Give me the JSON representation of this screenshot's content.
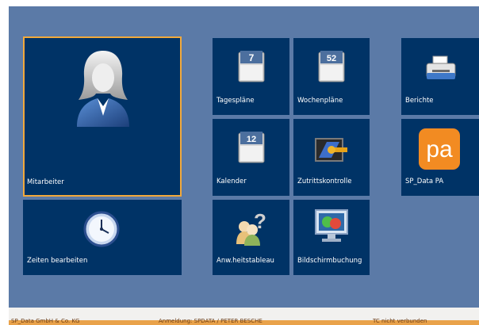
{
  "tiles": [
    {
      "id": "mitarbeiter",
      "label": "Mitarbeiter",
      "icon": "user-icon"
    },
    {
      "id": "zeiten",
      "label": "Zeiten bearbeiten",
      "icon": "clock-icon"
    },
    {
      "id": "tagesplaene",
      "label": "Tagespläne",
      "icon": "day-calendar-icon",
      "badge": "7"
    },
    {
      "id": "wochenplaene",
      "label": "Wochenpläne",
      "icon": "week-calendar-icon",
      "badge": "52"
    },
    {
      "id": "kalender",
      "label": "Kalender",
      "icon": "calendar-icon",
      "badge": "12"
    },
    {
      "id": "zutritt",
      "label": "Zutrittskontrolle",
      "icon": "access-control-icon"
    },
    {
      "id": "anwesenheit",
      "label": "Anw.heitstableau",
      "icon": "presence-board-icon"
    },
    {
      "id": "bildschirm",
      "label": "Bildschirmbuchung",
      "icon": "screen-booking-icon"
    },
    {
      "id": "berichte",
      "label": "Berichte",
      "icon": "printer-icon"
    },
    {
      "id": "spdata",
      "label": "SP_Data PA",
      "icon": "pa-logo-icon",
      "badge": "pa"
    }
  ],
  "status": {
    "company": "SP_Data GmbH & Co. KG",
    "user": "Anmeldung: SPDATA / PETER BESCHE",
    "info": "TC nicht verbunden"
  },
  "colors": {
    "background": "#5b7aa7",
    "tile": "#003366",
    "selected_border": "#f2a93b",
    "status_strip": "#e9a24a"
  }
}
